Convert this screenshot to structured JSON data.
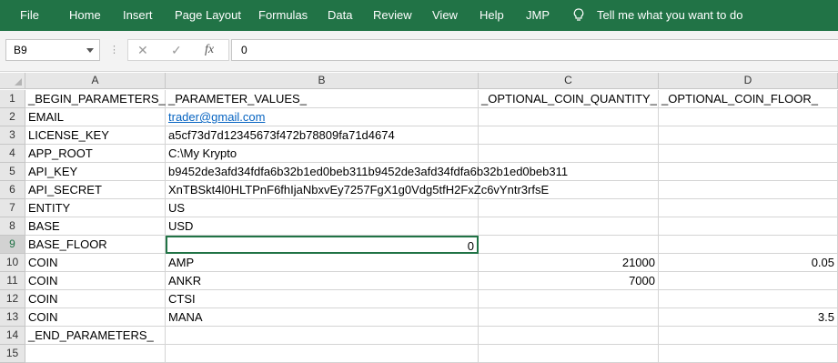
{
  "ribbon": {
    "tabs": [
      "File",
      "Home",
      "Insert",
      "Page Layout",
      "Formulas",
      "Data",
      "Review",
      "View",
      "Help",
      "JMP"
    ],
    "tell_me": "Tell me what you want to do",
    "accent": "#217346"
  },
  "formula_bar": {
    "name_box": "B9",
    "cancel_icon": "✕",
    "enter_icon": "✓",
    "fx_icon": "fx",
    "formula": "0"
  },
  "columns": [
    "A",
    "B",
    "C",
    "D"
  ],
  "rows": [
    {
      "n": "1",
      "a": "_BEGIN_PARAMETERS_",
      "b": "_PARAMETER_VALUES_",
      "c": "_OPTIONAL_COIN_QUANTITY_",
      "d": "_OPTIONAL_COIN_FLOOR_"
    },
    {
      "n": "2",
      "a": "EMAIL",
      "b": "trader@gmail.com",
      "c": "",
      "d": ""
    },
    {
      "n": "3",
      "a": "LICENSE_KEY",
      "b": "a5cf73d7d12345673f472b78809fa71d4674",
      "c": "",
      "d": ""
    },
    {
      "n": "4",
      "a": "APP_ROOT",
      "b": "C:\\My Krypto",
      "c": "",
      "d": ""
    },
    {
      "n": "5",
      "a": "API_KEY",
      "b": "b9452de3afd34fdfa6b32b1ed0beb311b9452de3afd34fdfa6b32b1ed0beb311",
      "c": "",
      "d": ""
    },
    {
      "n": "6",
      "a": "API_SECRET",
      "b": "XnTBSkt4l0HLTPnF6fhIjaNbxvEy7257FgX1g0Vdg5tfH2FxZc6vYntr3rfsE",
      "c": "",
      "d": ""
    },
    {
      "n": "7",
      "a": "ENTITY",
      "b": "US",
      "c": "",
      "d": ""
    },
    {
      "n": "8",
      "a": "BASE",
      "b": "USD",
      "c": "",
      "d": ""
    },
    {
      "n": "9",
      "a": "BASE_FLOOR",
      "b": "0",
      "c": "",
      "d": ""
    },
    {
      "n": "10",
      "a": "COIN",
      "b": "AMP",
      "c": "21000",
      "d": "0.05"
    },
    {
      "n": "11",
      "a": "COIN",
      "b": "ANKR",
      "c": "7000",
      "d": ""
    },
    {
      "n": "12",
      "a": "COIN",
      "b": "CTSI",
      "c": "",
      "d": ""
    },
    {
      "n": "13",
      "a": "COIN",
      "b": "MANA",
      "c": "",
      "d": "3.5"
    },
    {
      "n": "14",
      "a": "_END_PARAMETERS_",
      "b": "",
      "c": "",
      "d": ""
    },
    {
      "n": "15",
      "a": "",
      "b": "",
      "c": "",
      "d": ""
    }
  ]
}
